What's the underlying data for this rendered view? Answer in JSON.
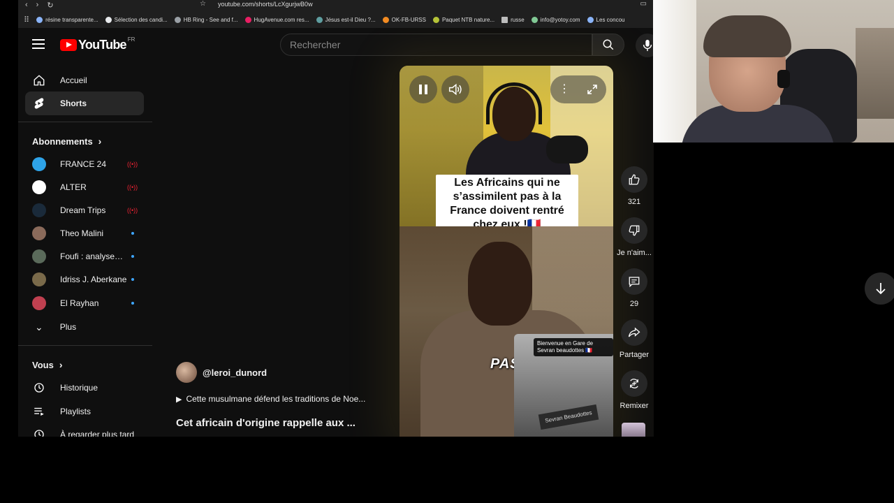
{
  "browser": {
    "url": "youtube.com/shorts/LcXgurjwB0w",
    "bookmarks": [
      {
        "label": "résine transparente...",
        "color": "#8ab4f8"
      },
      {
        "label": "Sélection des candi...",
        "color": "#e8eaed"
      },
      {
        "label": "HB Ring - See and f...",
        "color": "#9aa0a6"
      },
      {
        "label": "HugAvenue.com res...",
        "color": "#e91e63"
      },
      {
        "label": "Jésus est-il Dieu ?...",
        "color": "#5f9ea0"
      },
      {
        "label": "OK-FB-URSS",
        "color": "#f28b22"
      },
      {
        "label": "Paquet NTB nature...",
        "color": "#b5c338"
      },
      {
        "label": "russe",
        "color": "#bdbdbd"
      },
      {
        "label": "info@yotoy.com",
        "color": "#81c995"
      },
      {
        "label": "Les concou",
        "color": "#8ab4f8"
      }
    ]
  },
  "header": {
    "logo_text": "YouTube",
    "region": "FR",
    "search_placeholder": "Rechercher"
  },
  "sidebar": {
    "main": [
      {
        "label": "Accueil",
        "icon": "home-icon"
      },
      {
        "label": "Shorts",
        "icon": "shorts-icon",
        "active": true
      }
    ],
    "subscriptions_title": "Abonnements",
    "subscriptions": [
      {
        "label": "FRANCE 24",
        "color": "#2ea3e8",
        "status": "live"
      },
      {
        "label": "ALTER",
        "color": "#ffffff",
        "status": "live"
      },
      {
        "label": "Dream Trips",
        "color": "#1a2a3a",
        "status": "live"
      },
      {
        "label": "Theo Malini",
        "color": "#8a6a5a",
        "status": "new"
      },
      {
        "label": "Foufi : analyses ...",
        "color": "#5a6a5a",
        "status": "new"
      },
      {
        "label": "Idriss J. Aberkane",
        "color": "#7a6a4a",
        "status": "new"
      },
      {
        "label": "El Rayhan",
        "color": "#c04050",
        "status": "new"
      }
    ],
    "more_label": "Plus",
    "you_title": "Vous",
    "you_items": [
      {
        "label": "Historique",
        "icon": "history-icon"
      },
      {
        "label": "Playlists",
        "icon": "playlists-icon"
      },
      {
        "label": "À regarder plus tard",
        "icon": "watch-later-icon"
      }
    ]
  },
  "short": {
    "caption": "Les Africains qui ne s’assimilent pas à la France doivent rentré chez eux !🇫🇷",
    "overlay_text": "PAS",
    "inset_bubble": "Bienvenue en Gare de Sevran beaudottes 🇫🇷",
    "inset_sign": "Sevran Beaudottes",
    "channel": "@leroi_dunord",
    "playlist_line": "Cette musulmane  défend les traditions de Noe...",
    "title": "Cet africain d'origine rappelle aux ..."
  },
  "actions": {
    "likes": "321",
    "dislike_label": "Je n'aim...",
    "comments": "29",
    "share_label": "Partager",
    "remix_label": "Remixer"
  }
}
